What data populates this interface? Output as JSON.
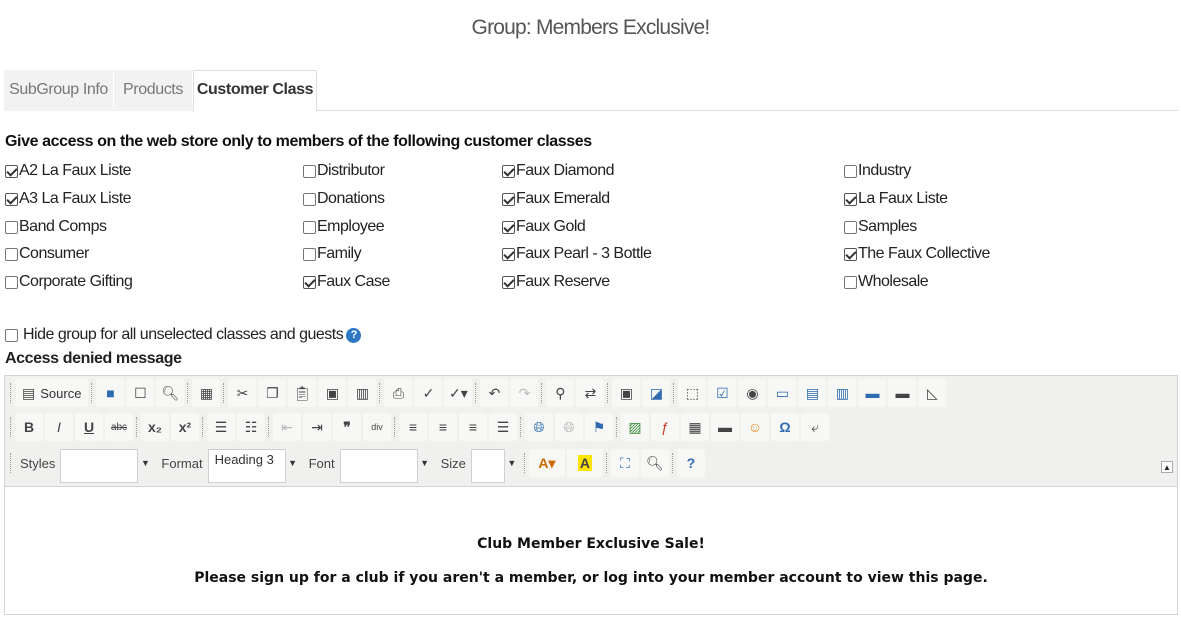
{
  "page_title": "Group: Members Exclusive!",
  "tabs": [
    {
      "label": "SubGroup Info",
      "active": false
    },
    {
      "label": "Products",
      "active": false
    },
    {
      "label": "Customer Class",
      "active": true
    }
  ],
  "customer_classes": {
    "heading": "Give access on the web store only to members of the following customer classes",
    "items": [
      {
        "label": "A2 La Faux Liste",
        "checked": true
      },
      {
        "label": "A3 La Faux Liste",
        "checked": true
      },
      {
        "label": "Band Comps",
        "checked": false
      },
      {
        "label": "Consumer",
        "checked": false
      },
      {
        "label": "Corporate Gifting",
        "checked": false
      },
      {
        "label": "Distributor",
        "checked": false
      },
      {
        "label": "Donations",
        "checked": false
      },
      {
        "label": "Employee",
        "checked": false
      },
      {
        "label": "Family",
        "checked": false
      },
      {
        "label": "Faux Case",
        "checked": true
      },
      {
        "label": "Faux Diamond",
        "checked": true
      },
      {
        "label": "Faux Emerald",
        "checked": true
      },
      {
        "label": "Faux Gold",
        "checked": true
      },
      {
        "label": "Faux Pearl - 3 Bottle",
        "checked": true
      },
      {
        "label": "Faux Reserve",
        "checked": true
      },
      {
        "label": "Industry",
        "checked": false
      },
      {
        "label": "La Faux Liste",
        "checked": true
      },
      {
        "label": "Samples",
        "checked": false
      },
      {
        "label": "The Faux Collective",
        "checked": true
      },
      {
        "label": "Wholesale",
        "checked": false
      }
    ]
  },
  "hide_group": {
    "label": "Hide group for all unselected classes and guests",
    "checked": false,
    "help_glyph": "?"
  },
  "access_denied_label": "Access denied message",
  "editor": {
    "source_label": "Source",
    "styles_label": "Styles",
    "styles_value": "",
    "format_label": "Format",
    "format_value": "Heading 3",
    "font_label": "Font",
    "font_value": "",
    "size_label": "Size",
    "size_value": "",
    "content_heading": "Club Member Exclusive Sale!",
    "content_text": "Please sign up for a club if you aren't a member, or log into your member account to view this page."
  },
  "accent_color": "#2f78c4"
}
